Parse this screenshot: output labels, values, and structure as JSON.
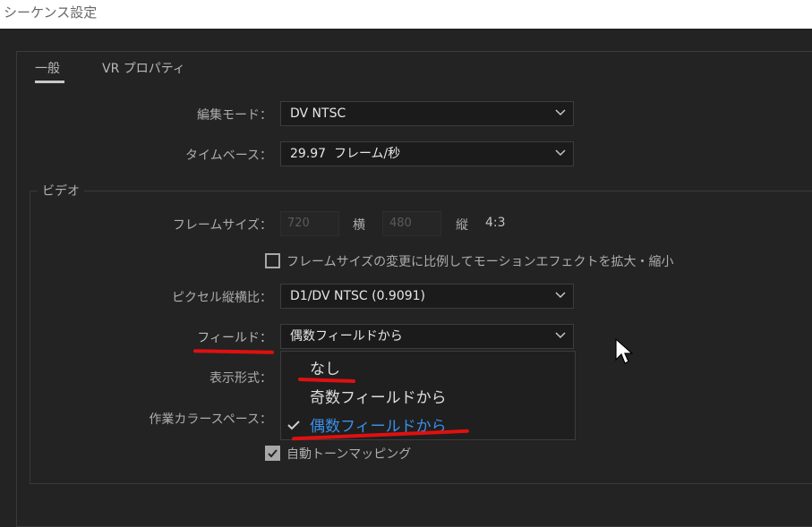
{
  "window": {
    "title": "シーケンス設定"
  },
  "tabs": [
    {
      "label": "一般",
      "active": true
    },
    {
      "label": "VR プロパティ",
      "active": false
    }
  ],
  "general": {
    "edit_mode_label": "編集モード：",
    "edit_mode_value": "DV NTSC",
    "timebase_label": "タイムベース：",
    "timebase_value": "29.97  フレーム/秒"
  },
  "video": {
    "group_title": "ビデオ",
    "frame_size_label": "フレームサイズ：",
    "frame_width": "720",
    "width_label": "横",
    "frame_height": "480",
    "height_label": "縦",
    "aspect": "4:3",
    "scale_checkbox_label": "フレームサイズの変更に比例してモーションエフェクトを拡大・縮小",
    "scale_checkbox_checked": false,
    "pixel_aspect_label": "ピクセル縦横比：",
    "pixel_aspect_value": "D1/DV NTSC (0.9091)",
    "fields_label": "フィールド：",
    "fields_value": "偶数フィールドから",
    "display_format_label": "表示形式：",
    "working_color_label": "作業カラースペース：",
    "auto_tone_label": "自動トーンマッピング",
    "auto_tone_checked": true
  },
  "fields_menu": {
    "options": [
      "なし",
      "奇数フィールドから",
      "偶数フィールドから"
    ],
    "selected_index": 2
  },
  "colors": {
    "selected_option": "#3b8fe8",
    "annotation_red": "#e01010",
    "background": "#232323"
  }
}
